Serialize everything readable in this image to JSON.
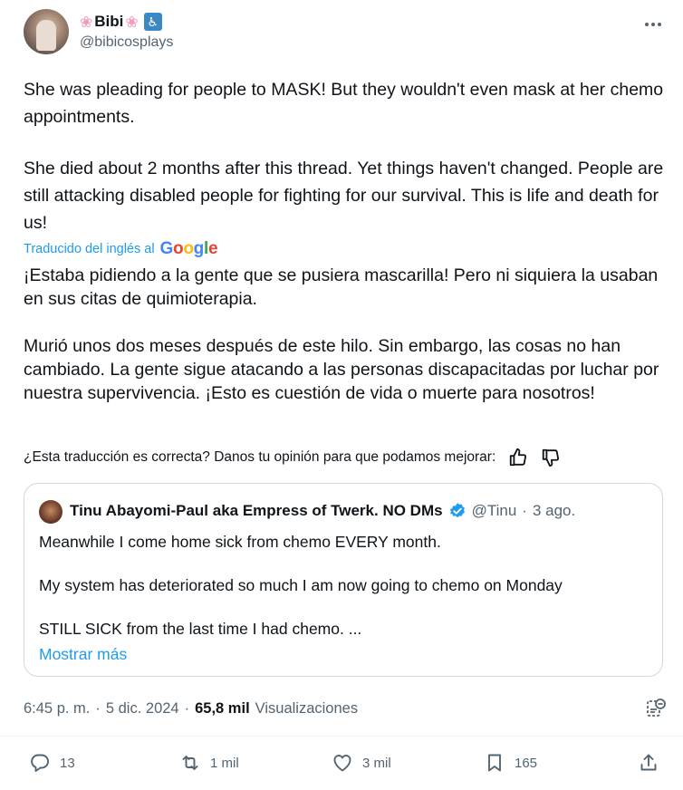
{
  "author": {
    "display_name": "Bibi",
    "handle": "@bibicosplays",
    "name_emojis": [
      "flower-icon",
      "flower-icon",
      "wheelchair-icon"
    ]
  },
  "tweet": {
    "paragraph1": "She was pleading for people to MASK! But they wouldn't even mask at her chemo appointments.",
    "paragraph2": "She died about 2 months after this thread. Yet things haven't changed. People are still attacking disabled people for fighting for our survival. This is life and death for us!",
    "translated_label": "Traducido del inglés al",
    "google_label": "Google",
    "translation_p1": "¡Estaba pidiendo a la gente que se pusiera mascarilla! Pero ni siquiera la usaban en sus citas de quimioterapia.",
    "translation_p2": "Murió unos dos meses después de este hilo. Sin embargo, las cosas no han cambiado. La gente sigue atacando a las personas discapacitadas por luchar por nuestra supervivencia. ¡Esto es cuestión de vida o muerte para nosotros!",
    "feedback_prompt": "¿Esta traducción es correcta? Danos tu opinión para que podamos mejorar:"
  },
  "quoted": {
    "name": "Tinu Abayomi-Paul aka Empress of Twerk. NO DMs",
    "handle": "@Tinu",
    "separator": "·",
    "date": "3 ago.",
    "line1": "Meanwhile I come home sick from chemo EVERY month.",
    "line2": "My system has deteriorated so much I am now going to chemo on Monday",
    "line3": "STILL SICK from the last time I had chemo. ...",
    "show_more": "Mostrar más"
  },
  "meta": {
    "time": "6:45 p. m.",
    "sep1": "·",
    "date": "5 dic. 2024",
    "sep2": "·",
    "views_count": "65,8 mil",
    "views_label": "Visualizaciones"
  },
  "actions": {
    "replies": "13",
    "reposts": "1 mil",
    "likes": "3 mil",
    "bookmarks": "165"
  },
  "colors": {
    "accent": "#1d9bf0",
    "text": "#0f1419",
    "muted": "#536471",
    "border": "#cfd9de"
  }
}
